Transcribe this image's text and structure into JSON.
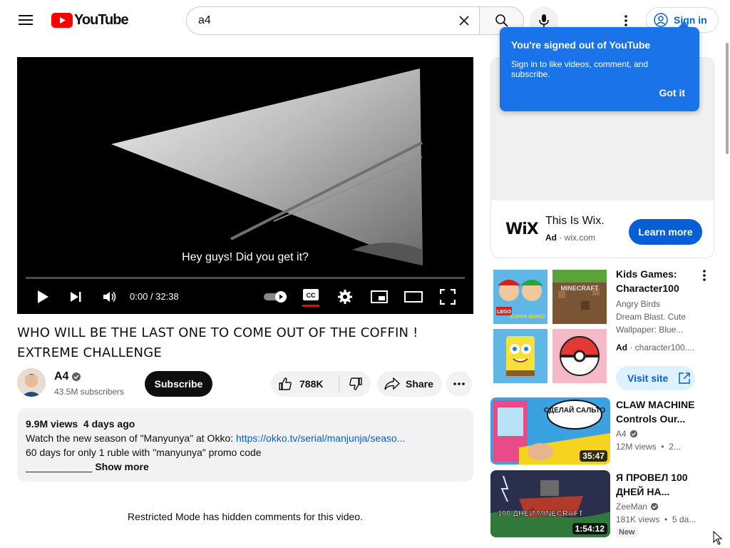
{
  "header": {
    "logo_text": "YouTube",
    "search_value": "a4",
    "signin_label": "Sign in"
  },
  "tooltip": {
    "title": "You're signed out of YouTube",
    "body": "Sign in to like videos, comment, and subscribe.",
    "button": "Got it"
  },
  "player": {
    "caption": "Hey guys! Did you get it?",
    "time": "0:00 / 32:38",
    "progress": 0.0
  },
  "video": {
    "title": "WHO WILL BE THE LAST ONE TO COME OUT OF THE COFFIN ! EXTREME CHALLENGE",
    "channel": "A4",
    "subscribers": "43.5M subscribers",
    "subscribe_label": "Subscribe",
    "likes": "788K",
    "share_label": "Share"
  },
  "description": {
    "stats": "9.9M views  4 days ago",
    "line1_text": "Watch the new season of \"Manyunya\" at Okko: ",
    "line1_link": "https://okko.tv/serial/manjunja/seaso...",
    "line2": "60 days for only 1 ruble with \"manyunya\" promo code",
    "line3_rule": "____________",
    "show_more": "Show more"
  },
  "comments": {
    "restricted_notice": "Restricted Mode has hidden comments for this video."
  },
  "ad_card": {
    "logo": "WiX",
    "title": "This Is Wix.",
    "ad_label": "Ad",
    "domain": "wix.com",
    "cta": "Learn more"
  },
  "ad_games": {
    "title": "Kids Games: Character100",
    "description": "Angry Birds Dream Blast. Cute Wallpaper: Blue...",
    "ad_label": "Ad",
    "domain": "character100....",
    "cta": "Visit site",
    "tile_labels": [
      "LEGO",
      "SUPER MARIO",
      "MINECRAFT"
    ]
  },
  "recommendations": [
    {
      "title": "CLAW MACHINE Controls Our...",
      "channel": "A4",
      "meta": "12M views  •  2...",
      "duration": "35:47",
      "thumb_text": "СДЕЛАЙ САЛЬТО"
    },
    {
      "title": "Я ПРОВЕЛ 100 ДНЕЙ НА...",
      "channel": "ZeeMan",
      "meta": "181K views  •  5 da...",
      "duration": "1:54:12",
      "badge": "New",
      "thumb_text": "100 ДНЕЙ MINECRAFT"
    }
  ],
  "colors": {
    "brand_red": "#ff0000",
    "link_blue": "#065fd4",
    "tooltip_blue": "#1a73e8"
  }
}
